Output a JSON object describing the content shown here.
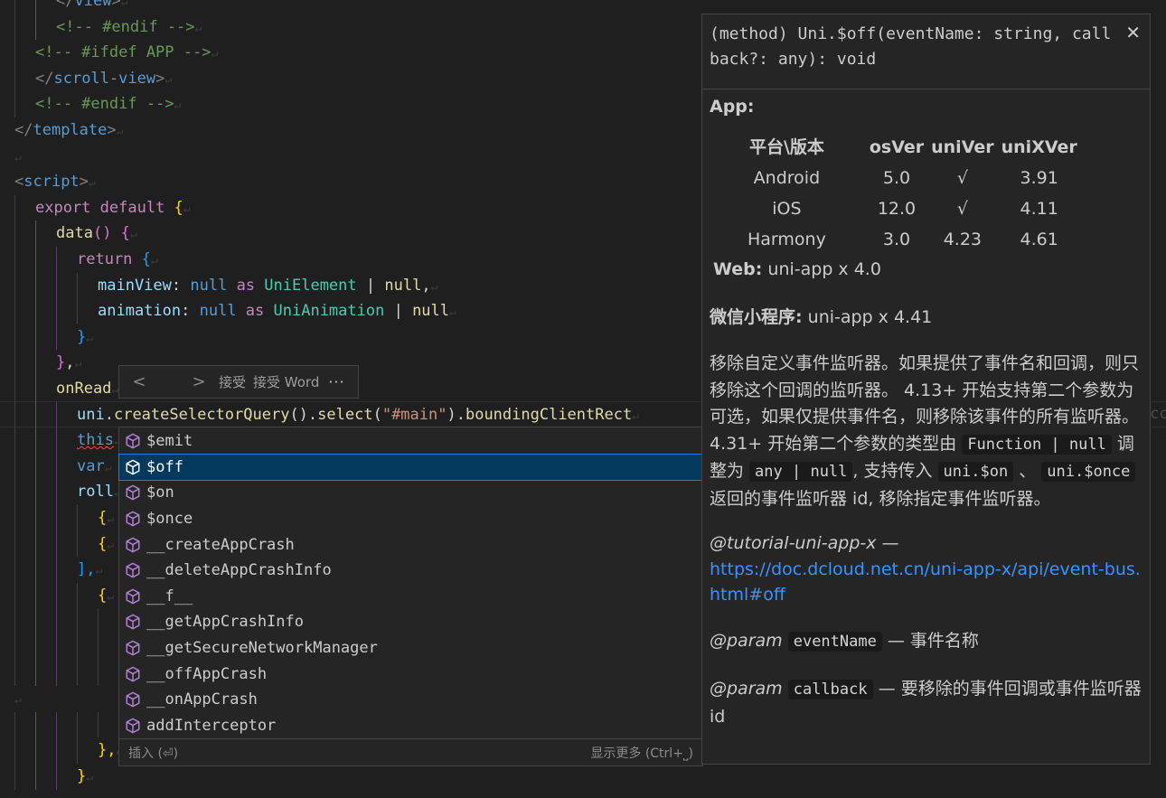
{
  "editor": {
    "lines": [
      {
        "indent": 2,
        "tokens": [
          {
            "t": "</",
            "c": "tok-punc"
          },
          {
            "t": "view",
            "c": "tok-tag"
          },
          {
            "t": ">",
            "c": "tok-punc"
          }
        ]
      },
      {
        "indent": 2,
        "tokens": [
          {
            "t": "<!-- #endif -->",
            "c": "tok-cmt"
          }
        ]
      },
      {
        "indent": 1,
        "tokens": [
          {
            "t": "<!-- #ifdef APP -->",
            "c": "tok-cmt"
          }
        ]
      },
      {
        "indent": 1,
        "tokens": [
          {
            "t": "</",
            "c": "tok-punc"
          },
          {
            "t": "scroll-view",
            "c": "tok-tag"
          },
          {
            "t": ">",
            "c": "tok-punc"
          }
        ]
      },
      {
        "indent": 1,
        "tokens": [
          {
            "t": "<!-- #endif -->",
            "c": "tok-cmt"
          }
        ]
      },
      {
        "indent": 0,
        "tokens": [
          {
            "t": "</",
            "c": "tok-punc"
          },
          {
            "t": "template",
            "c": "tok-tag"
          },
          {
            "t": ">",
            "c": "tok-punc"
          }
        ]
      },
      {
        "indent": 0,
        "tokens": []
      },
      {
        "indent": 0,
        "tokens": [
          {
            "t": "<",
            "c": "tok-punc"
          },
          {
            "t": "script",
            "c": "tok-tag"
          },
          {
            "t": ">",
            "c": "tok-punc"
          }
        ]
      },
      {
        "indent": 1,
        "tokens": [
          {
            "t": "export ",
            "c": "tok-kw2"
          },
          {
            "t": "default ",
            "c": "tok-kw2"
          },
          {
            "t": "{",
            "c": "tok-br1"
          }
        ]
      },
      {
        "indent": 2,
        "tokens": [
          {
            "t": "data",
            "c": "tok-fn"
          },
          {
            "t": "() ",
            "c": "tok-br2"
          },
          {
            "t": "{",
            "c": "tok-br2"
          }
        ]
      },
      {
        "indent": 3,
        "tokens": [
          {
            "t": "return ",
            "c": "tok-kw2"
          },
          {
            "t": "{",
            "c": "tok-br3"
          }
        ]
      },
      {
        "indent": 4,
        "tokens": [
          {
            "t": "mainView",
            "c": "tok-prop"
          },
          {
            "t": ": ",
            "c": "tok-text"
          },
          {
            "t": "null ",
            "c": "tok-kw"
          },
          {
            "t": "as ",
            "c": "tok-kw2"
          },
          {
            "t": "UniElement ",
            "c": "tok-type"
          },
          {
            "t": "| ",
            "c": "tok-text"
          },
          {
            "t": "null",
            "c": "tok-fn"
          },
          {
            "t": ",",
            "c": "tok-text"
          }
        ]
      },
      {
        "indent": 4,
        "tokens": [
          {
            "t": "animation",
            "c": "tok-prop"
          },
          {
            "t": ": ",
            "c": "tok-text"
          },
          {
            "t": "null ",
            "c": "tok-kw"
          },
          {
            "t": "as ",
            "c": "tok-kw2"
          },
          {
            "t": "UniAnimation ",
            "c": "tok-type"
          },
          {
            "t": "| ",
            "c": "tok-text"
          },
          {
            "t": "null",
            "c": "tok-fn"
          }
        ]
      },
      {
        "indent": 3,
        "tokens": [
          {
            "t": "}",
            "c": "tok-br3"
          }
        ]
      },
      {
        "indent": 2,
        "tokens": [
          {
            "t": "}",
            "c": "tok-br2"
          },
          {
            "t": ",",
            "c": "tok-text"
          }
        ]
      },
      {
        "indent": 2,
        "tokens": [
          {
            "t": "onRead",
            "c": "tok-fn"
          }
        ]
      },
      {
        "indent": 3,
        "tokens": [
          {
            "t": "uni",
            "c": "tok-prop"
          },
          {
            "t": ".",
            "c": "tok-text"
          },
          {
            "t": "createSelectorQuery",
            "c": "tok-fn"
          },
          {
            "t": "().",
            "c": "tok-text"
          },
          {
            "t": "select",
            "c": "tok-fn"
          },
          {
            "t": "(",
            "c": "tok-text"
          },
          {
            "t": "\"#main\"",
            "c": "tok-str"
          },
          {
            "t": ").",
            "c": "tok-text"
          },
          {
            "t": "boundingClientRect",
            "c": "tok-fn"
          }
        ]
      },
      {
        "indent": 3,
        "tokens": [
          {
            "t": "this",
            "c": "tok-kw squiggle"
          }
        ]
      },
      {
        "indent": 3,
        "tokens": [
          {
            "t": "var",
            "c": "tok-kw"
          }
        ]
      },
      {
        "indent": 3,
        "tokens": [
          {
            "t": "roll",
            "c": "tok-prop"
          }
        ]
      },
      {
        "indent": 4,
        "tokens": [
          {
            "t": "{",
            "c": "tok-br1"
          }
        ]
      },
      {
        "indent": 4,
        "tokens": [
          {
            "t": "{",
            "c": "tok-br1"
          }
        ]
      },
      {
        "indent": 3,
        "tokens": [
          {
            "t": "],",
            "c": "tok-br3"
          }
        ]
      },
      {
        "indent": 4,
        "tokens": [
          {
            "t": "{",
            "c": "tok-br1"
          }
        ]
      },
      {
        "indent": 5,
        "tokens": []
      },
      {
        "indent": 5,
        "tokens": []
      },
      {
        "indent": 5,
        "tokens": []
      },
      {
        "indent": 0,
        "tokens": []
      },
      {
        "indent": 5,
        "tokens": []
      },
      {
        "indent": 4,
        "tokens": [
          {
            "t": "},",
            "c": "tok-br1"
          }
        ]
      },
      {
        "indent": 3,
        "tokens": [
          {
            "t": "}",
            "c": "tok-br1"
          }
        ]
      }
    ],
    "right_overflow_text": "cc"
  },
  "inline_toolbar": {
    "prev": "<",
    "next": ">",
    "accept": "接受",
    "accept_word": "接受 Word",
    "more": "···"
  },
  "completion": {
    "items": [
      {
        "label": "$emit",
        "selected": false
      },
      {
        "label": "$off",
        "selected": true
      },
      {
        "label": "$on",
        "selected": false
      },
      {
        "label": "$once",
        "selected": false
      },
      {
        "label": "__createAppCrash",
        "selected": false
      },
      {
        "label": "__deleteAppCrashInfo",
        "selected": false
      },
      {
        "label": "__f__",
        "selected": false
      },
      {
        "label": "__getAppCrashInfo",
        "selected": false
      },
      {
        "label": "__getSecureNetworkManager",
        "selected": false
      },
      {
        "label": "__offAppCrash",
        "selected": false
      },
      {
        "label": "__onAppCrash",
        "selected": false
      },
      {
        "label": "addInterceptor",
        "selected": false
      }
    ],
    "footer_left": "插入 (⏎)",
    "footer_right": "显示更多 (Ctrl+⎵)",
    "icon_color": "#b180d7"
  },
  "doc": {
    "signature": "(method) Uni.$off(eventName: string, callback?: any): void",
    "close": "✕",
    "app_heading": "App:",
    "table_headers": [
      "平台\\版本",
      "osVer",
      "uniVer",
      "uniXVer"
    ],
    "table_rows": [
      [
        "Android",
        "5.0",
        "√",
        "3.91"
      ],
      [
        "iOS",
        "12.0",
        "√",
        "4.11"
      ],
      [
        "Harmony",
        "3.0",
        "4.23",
        "4.61"
      ]
    ],
    "web_label": "Web:",
    "web_value": " uni-app x 4.0",
    "wx_label": "微信小程序:",
    "wx_value": " uni-app x 4.41",
    "desc_1": "移除自定义事件监听器。如果提供了事件名和回调，则只移除这个回调的监听器。 4.13+ 开始支持第二个参数为可选，如果仅提供事件名，则移除该事件的所有监听器。 4.31+ 开始第二个参数的类型由 ",
    "desc_code_1": "Function | null",
    "desc_2": " 调整为 ",
    "desc_code_2": "any | null",
    "desc_3": ", 支持传入 ",
    "desc_code_3": "uni.$on",
    "desc_4": " 、 ",
    "desc_code_4": "uni.$once",
    "desc_5": " 返回的事件监听器 id, 移除指定事件监听器。",
    "tutorial_tag": "@tutorial-uni-app-x",
    "tutorial_dash": " —",
    "tutorial_link": "https://doc.dcloud.net.cn/uni-app-x/api/event-bus.html#off",
    "param1_tag": "@param",
    "param1_name": "eventName",
    "param1_desc": " — 事件名称",
    "param2_tag": "@param",
    "param2_name": "callback",
    "param2_desc": " — 要移除的事件回调或事件监听器 id"
  }
}
